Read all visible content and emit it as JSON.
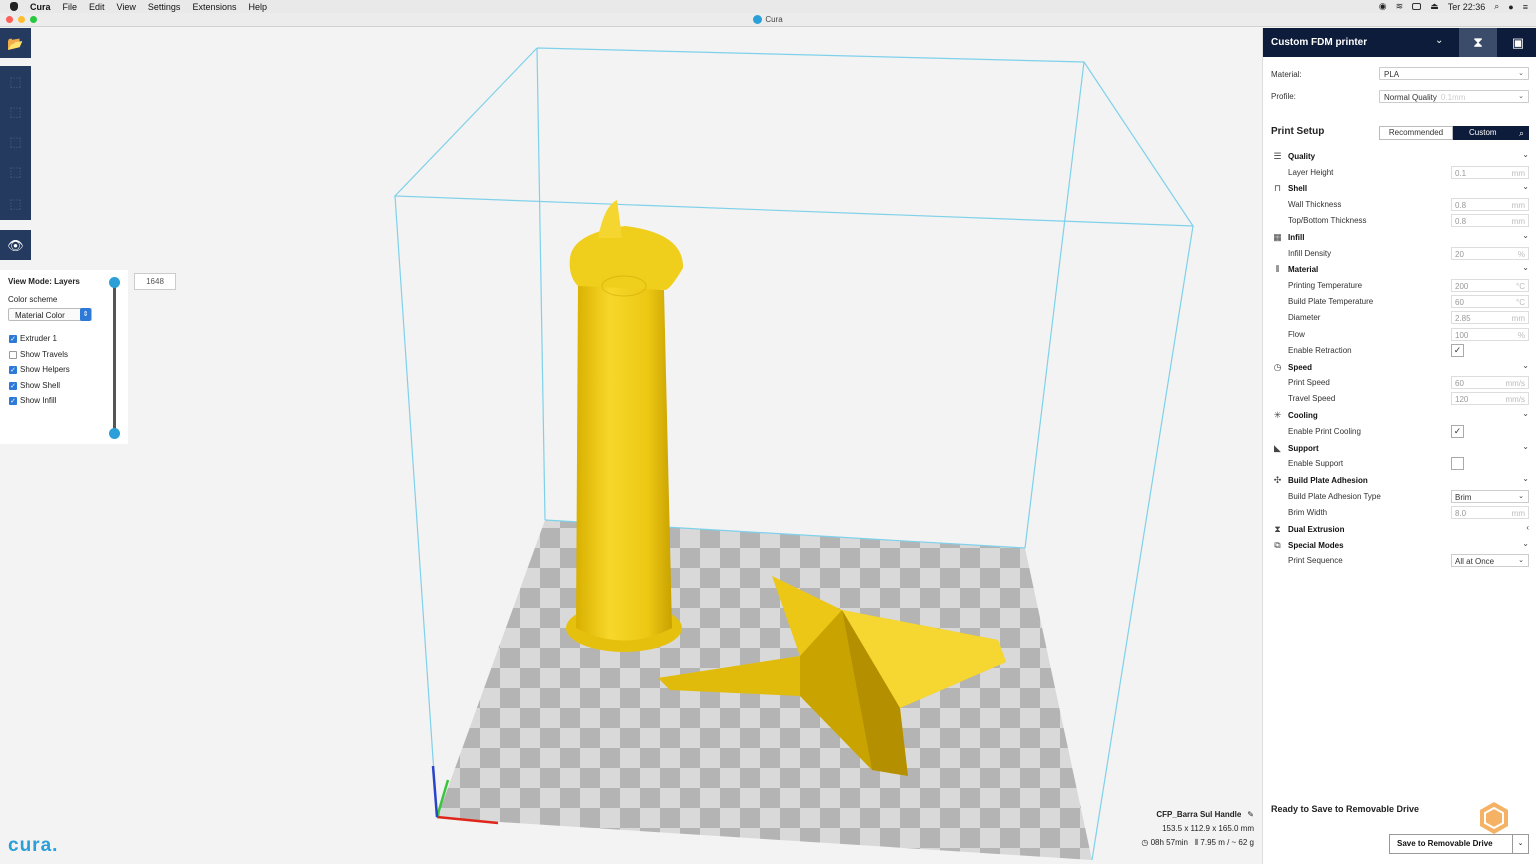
{
  "menubar": {
    "app": "Cura",
    "items": [
      "File",
      "Edit",
      "View",
      "Settings",
      "Extensions",
      "Help"
    ],
    "clock": "Ter 22:36"
  },
  "window": {
    "title": "Cura"
  },
  "layer_view": {
    "title": "View Mode: Layers",
    "color_scheme_label": "Color scheme",
    "color_scheme_value": "Material Color",
    "layer_number": "1648",
    "checkboxes": [
      {
        "label": "Extruder 1",
        "checked": true
      },
      {
        "label": "Show Travels",
        "checked": false
      },
      {
        "label": "Show Helpers",
        "checked": true
      },
      {
        "label": "Show Shell",
        "checked": true
      },
      {
        "label": "Show Infill",
        "checked": true
      }
    ]
  },
  "logo_text": "cura",
  "job": {
    "name": "CFP_Barra Sul Handle",
    "dimensions": "153.5 x 112.9 x 165.0 mm",
    "time": "08h 57min",
    "material_usage": "7.95 m / ~ 62 g"
  },
  "printer": {
    "name": "Custom FDM printer",
    "material_label": "Material:",
    "material_value": "PLA",
    "profile_label": "Profile:",
    "profile_value": "Normal Quality",
    "profile_hint": "0.1mm"
  },
  "print_setup": {
    "title": "Print Setup",
    "tab_recommended": "Recommended",
    "tab_custom": "Custom"
  },
  "categories": {
    "quality": "Quality",
    "shell": "Shell",
    "infill": "Infill",
    "material": "Material",
    "speed": "Speed",
    "cooling": "Cooling",
    "support": "Support",
    "adhesion": "Build Plate Adhesion",
    "dual": "Dual Extrusion",
    "special": "Special Modes"
  },
  "settings": {
    "layer_height": {
      "label": "Layer Height",
      "value": "0.1",
      "unit": "mm"
    },
    "wall_thickness": {
      "label": "Wall Thickness",
      "value": "0.8",
      "unit": "mm"
    },
    "topbottom_thickness": {
      "label": "Top/Bottom Thickness",
      "value": "0.8",
      "unit": "mm"
    },
    "infill_density": {
      "label": "Infill Density",
      "value": "20",
      "unit": "%"
    },
    "print_temp": {
      "label": "Printing Temperature",
      "value": "200",
      "unit": "°C"
    },
    "bed_temp": {
      "label": "Build Plate Temperature",
      "value": "60",
      "unit": "°C"
    },
    "diameter": {
      "label": "Diameter",
      "value": "2.85",
      "unit": "mm"
    },
    "flow": {
      "label": "Flow",
      "value": "100",
      "unit": "%"
    },
    "retraction": {
      "label": "Enable Retraction",
      "checked": true
    },
    "print_speed": {
      "label": "Print Speed",
      "value": "60",
      "unit": "mm/s"
    },
    "travel_speed": {
      "label": "Travel Speed",
      "value": "120",
      "unit": "mm/s"
    },
    "print_cooling": {
      "label": "Enable Print Cooling",
      "checked": true
    },
    "enable_support": {
      "label": "Enable Support",
      "checked": false
    },
    "adhesion_type": {
      "label": "Build Plate Adhesion Type",
      "value": "Brim"
    },
    "brim_width": {
      "label": "Brim Width",
      "value": "8.0",
      "unit": "mm"
    },
    "print_sequence": {
      "label": "Print Sequence",
      "value": "All at Once"
    }
  },
  "footer": {
    "ready": "Ready to Save to Removable Drive",
    "save_button": "Save to Removable Drive"
  },
  "colors": {
    "accent": "#2a9fd8",
    "header": "#0d1c3a",
    "toolbar": "#243a5e",
    "model": "#f2cc12"
  }
}
